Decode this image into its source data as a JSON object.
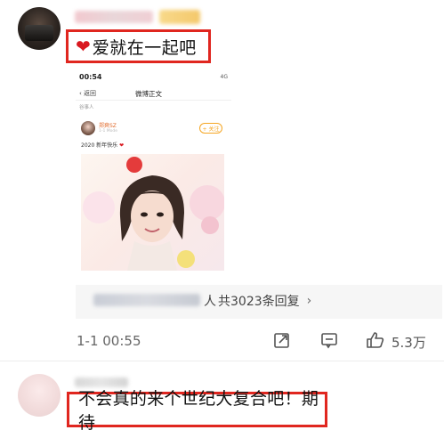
{
  "comment_1": {
    "avatar_icon": "user-avatar",
    "text": "爱就在一起吧",
    "heart_glyph": "❤"
  },
  "embedded_screenshot": {
    "status_time": "00:54",
    "status_signal": "4G",
    "back_label": "返回",
    "page_title": "微博正文",
    "subheader": "谷事人",
    "poster_name": "郑爽SZ",
    "poster_meta": "1-1 Mode",
    "follow_label": "+ 关注",
    "post_text": "2020 新年快乐",
    "post_heart": "❤",
    "photo_caption_icon": "portrait-photo"
  },
  "reply_summary": {
    "suffix": "人",
    "count_text": "共3023条回复"
  },
  "actions": {
    "date": "1-1 00:55",
    "like_count": "5.3万"
  },
  "comment_2": {
    "text": "不会真的来个世纪大复合吧！期待"
  },
  "colors": {
    "highlight_border": "#e0261f",
    "heart": "#d9181f",
    "follow_accent": "#f5a623"
  }
}
